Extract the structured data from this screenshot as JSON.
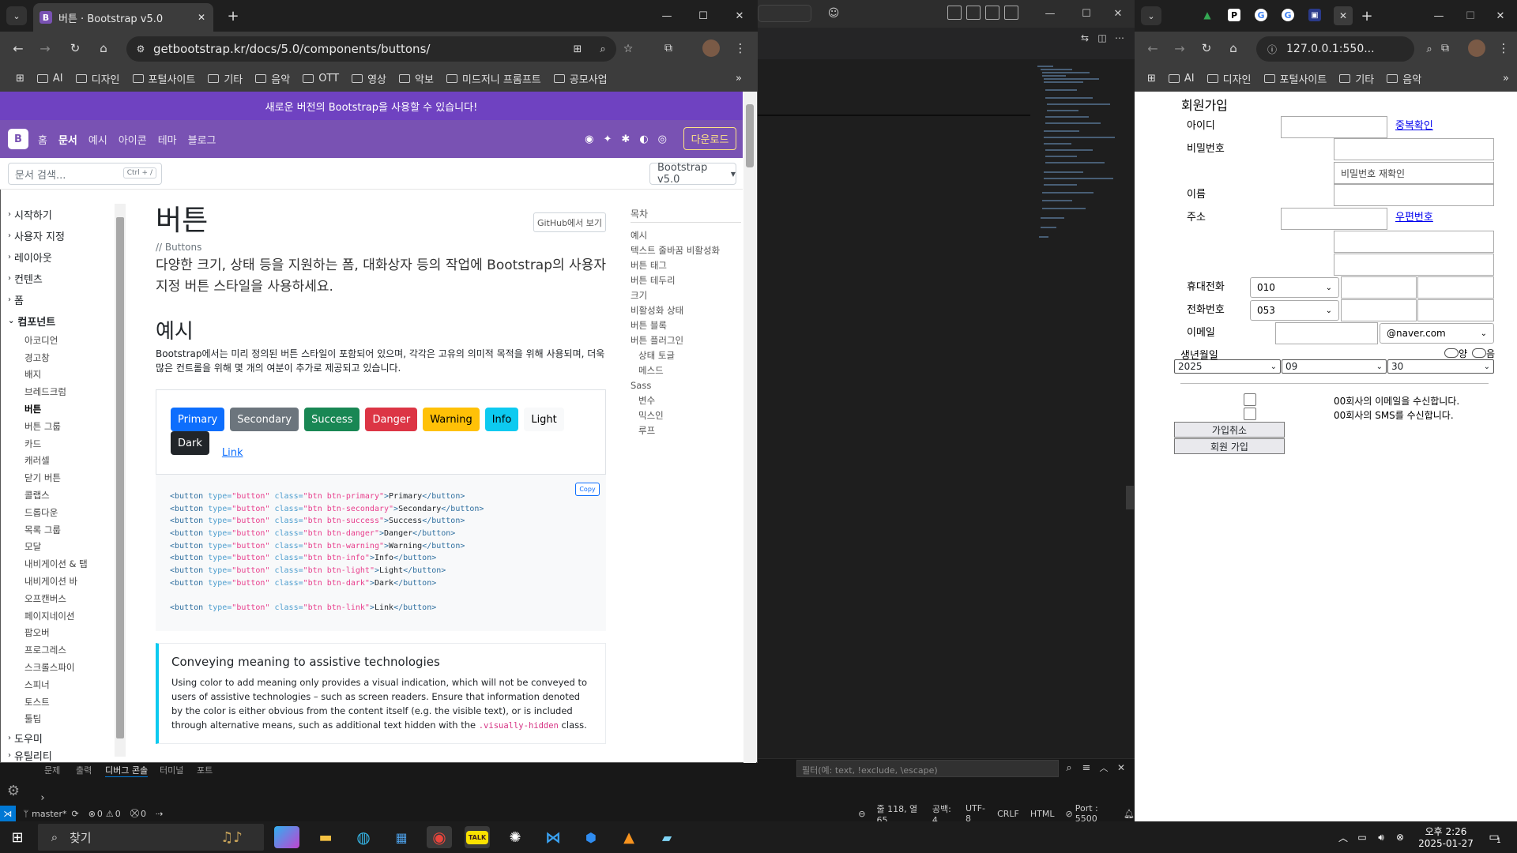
{
  "left_browser": {
    "tab_title": "버튼 · Bootstrap v5.0",
    "url": "getbootstrap.kr/docs/5.0/components/buttons/",
    "bookmarks": [
      "AI",
      "디자인",
      "포털사이트",
      "기타",
      "음악",
      "OTT",
      "영상",
      "악보",
      "미드저니 프롬프트",
      "공모사업"
    ]
  },
  "bootstrap": {
    "banner": "새로운 버전의 Bootstrap을 사용할 수 있습니다!",
    "logo": "B",
    "nav": [
      "홈",
      "문서",
      "예시",
      "아이콘",
      "테마",
      "블로그"
    ],
    "download": "다운로드",
    "search_placeholder": "문서 검색...",
    "search_kbd": "Ctrl + /",
    "version": "Bootstrap v5.0",
    "sidebar": {
      "sections": [
        "시작하기",
        "사용자 지정",
        "레이아웃",
        "컨텐츠",
        "폼",
        "컴포넌트",
        "도우미",
        "유틸리티"
      ],
      "components": [
        "아코디언",
        "경고창",
        "배지",
        "브레드크럼",
        "버튼",
        "버튼 그룹",
        "카드",
        "캐러셀",
        "닫기 버튼",
        "콜랩스",
        "드롭다운",
        "목록 그룹",
        "모달",
        "내비게이션 & 탭",
        "내비게이션 바",
        "오프캔버스",
        "페이지네이션",
        "팝오버",
        "프로그레스",
        "스크롤스파이",
        "스피너",
        "토스트",
        "툴팁"
      ]
    },
    "title": "버튼",
    "github": "GitHub에서 보기",
    "subtitle": "// Buttons",
    "lead": "다양한 크기, 상태 등을 지원하는 폼, 대화상자 등의 작업에 Bootstrap의 사용자 지정 버튼 스타일을 사용하세요.",
    "h2": "예시",
    "desc": "Bootstrap에서는 미리 정의된 버튼 스타일이 포함되어 있으며, 각각은 고유의 의미적 목적을 위해 사용되며, 더욱 많은 컨트롤을 위해 몇 개의 여분이 추가로 제공되고 있습니다.",
    "buttons": [
      "Primary",
      "Secondary",
      "Success",
      "Danger",
      "Warning",
      "Info",
      "Light",
      "Dark",
      "Link"
    ],
    "copy": "Copy",
    "code": [
      {
        "cls": "btn btn-primary",
        "text": "Primary"
      },
      {
        "cls": "btn btn-secondary",
        "text": "Secondary"
      },
      {
        "cls": "btn btn-success",
        "text": "Success"
      },
      {
        "cls": "btn btn-danger",
        "text": "Danger"
      },
      {
        "cls": "btn btn-warning",
        "text": "Warning"
      },
      {
        "cls": "btn btn-info",
        "text": "Info"
      },
      {
        "cls": "btn btn-light",
        "text": "Light"
      },
      {
        "cls": "btn btn-dark",
        "text": "Dark"
      },
      {
        "cls": "btn btn-link",
        "text": "Link"
      }
    ],
    "callout_title": "Conveying meaning to assistive technologies",
    "callout_body": "Using color to add meaning only provides a visual indication, which will not be conveyed to users of assistive technologies – such as screen readers. Ensure that information denoted by the color is either obvious from the content itself (e.g. the visible text), or is included through alternative means, such as additional text hidden with the",
    "callout_code": ".visually-hidden",
    "callout_end": "class.",
    "toc_title": "목차",
    "toc": [
      {
        "label": "예시",
        "indent": false
      },
      {
        "label": "텍스트 줄바꿈 비활성화",
        "indent": false
      },
      {
        "label": "버튼 태그",
        "indent": false
      },
      {
        "label": "버튼 테두리",
        "indent": false
      },
      {
        "label": "크기",
        "indent": false
      },
      {
        "label": "비활성화 상태",
        "indent": false
      },
      {
        "label": "버튼 블록",
        "indent": false
      },
      {
        "label": "버튼 플러그인",
        "indent": false
      },
      {
        "label": "상태 토글",
        "indent": true
      },
      {
        "label": "메스드",
        "indent": true
      },
      {
        "label": "Sass",
        "indent": false
      },
      {
        "label": "변수",
        "indent": true
      },
      {
        "label": "믹스인",
        "indent": true
      },
      {
        "label": "루프",
        "indent": true
      }
    ]
  },
  "right_browser": {
    "url": "127.0.0.1:550...",
    "bookmarks": [
      "AI",
      "디자인",
      "포털사이트",
      "기타",
      "음악"
    ],
    "form": {
      "title": "회원가입",
      "id_label": "아이디",
      "dup_check": "중복확인",
      "pw_label": "비밀번호",
      "pw_confirm_placeholder": "비밀번호 재확인",
      "name_label": "이름",
      "addr_label": "주소",
      "zip_link": "우편번호",
      "mobile_label": "휴대전화",
      "mobile_prefix": "010",
      "phone_label": "전화번호",
      "phone_prefix": "053",
      "email_label": "이메일",
      "email_domain": "@naver.com",
      "birth_label": "생년월일",
      "calendar_options": [
        "양",
        "음"
      ],
      "year": "2025",
      "month": "09",
      "day": "30",
      "email_consent": "00회사의 이메일을 수신합니다.",
      "sms_consent": "00회사의 SMS를 수신합니다.",
      "cancel": "가입취소",
      "submit": "회원 가입"
    }
  },
  "vscode": {
    "panel_tabs": [
      "문제",
      "출력",
      "디버그 콘솔",
      "터미널",
      "포트"
    ],
    "active_panel": "디버그 콘솔",
    "filter_placeholder": "필터(예: text, !exclude, \\escape)",
    "status": {
      "branch": "master*",
      "problems": "0",
      "warnings": "0",
      "ports": "0",
      "position": "줄 118, 열 65",
      "spaces": "공백: 4",
      "encoding": "UTF-8",
      "eol": "CRLF",
      "language": "HTML",
      "port": "Port : 5500"
    }
  },
  "taskbar": {
    "search": "찾기",
    "time": "오후 2:26",
    "date": "2025-01-27",
    "notifications": "1"
  },
  "colors": {
    "primary": "#0d6efd",
    "secondary": "#6c757d",
    "success": "#198754",
    "danger": "#dc3545",
    "warning": "#ffc107",
    "info": "#0dcaf0",
    "light": "#f8f9fa",
    "dark": "#212529",
    "bs_purple": "#7952b3"
  }
}
